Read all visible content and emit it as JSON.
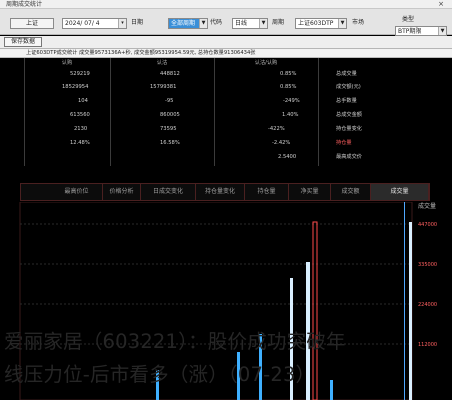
{
  "window": {
    "title": "周期成交统计",
    "close_glyph": "×"
  },
  "toolbar": {
    "category_label": "类型",
    "category_value": "BTP期限",
    "market_label": "市场",
    "market_value": "上证",
    "code_label": "代码",
    "code_value": "上证603DTP",
    "period_label": "周期",
    "period_value": "日线",
    "date_value": "2024/ 07/ 4",
    "date_label": "日期",
    "mode_value": "全部周期",
    "save_label": "保存"
  },
  "summary": {
    "button_label": "保存数据",
    "text": "上证603DTP成交统计 成交量9573136A+秒, 成交金额95319954.59元, 总持仓数量91306434张"
  },
  "stats": {
    "headers": [
      "",
      "认购",
      "认沽",
      "认沽/认购"
    ],
    "rows": [
      {
        "label": "总成交量",
        "call": "529219",
        "put": "448812",
        "ratio": "0.85%"
      },
      {
        "label": "成交额(元)",
        "call": "18529954",
        "put": "15799381",
        "ratio": "0.85%"
      },
      {
        "label": "总手数量",
        "call": "104",
        "put": "-95",
        "ratio": "-249%"
      },
      {
        "label": "总成交金额",
        "call": "613560",
        "put": "860005",
        "ratio": "1.40%"
      },
      {
        "label": "持仓量变化",
        "call": "2130",
        "put": "73595",
        "ratio": "-422%"
      },
      {
        "label": "持仓量",
        "call": "12.48%",
        "put": "16.58%",
        "ratio": "-2.42%"
      },
      {
        "label": "最高成交价",
        "call": "",
        "put": "",
        "ratio": "2.5400"
      }
    ]
  },
  "tabs": [
    "成交量",
    "成交额",
    "净买量",
    "持仓量",
    "持仓量变化",
    "日成交变化",
    "价格分析",
    "最高价位"
  ],
  "chart_data": {
    "type": "bar",
    "y_ticks": [
      "447000",
      "335000",
      "224000",
      "112000"
    ],
    "legend": "成交量"
  },
  "overlay": {
    "line1": "爱丽家居（603221）：股价成功突破年",
    "line2": "线压力位-后市看多（涨）（07-23）"
  },
  "colors": {
    "call_bar": "#3fb0ff",
    "put_bar": "#ff4a4a",
    "highlight_bar": "#d9efff"
  }
}
